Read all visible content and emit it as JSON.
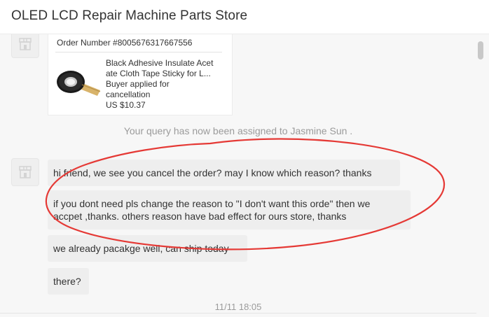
{
  "header": {
    "title": "OLED LCD Repair Machine Parts Store"
  },
  "order": {
    "number_label": "Order Number #8005676317667556",
    "product_lines": [
      "Black Adhesive Insulate Acet",
      "ate Cloth Tape Sticky for L..."
    ],
    "status_lines": [
      "Buyer applied for",
      "cancellation"
    ],
    "price": "US $10.37"
  },
  "system_message": "Your query has now been assigned to Jasmine Sun .",
  "messages": [
    {
      "lines": [
        "hi friend, we see you cancel the order? may I know which reason? thanks"
      ]
    },
    {
      "lines": [
        "if you dont need pls change the reason to \"I don't want this orde\" then we",
        "accpet ,thanks. others reason have bad effect for ours store, thanks"
      ]
    },
    {
      "lines": [
        "we already pacakge well, can ship today"
      ]
    },
    {
      "lines": [
        "there?"
      ]
    }
  ],
  "timestamp": "11/11 18:05",
  "colors": {
    "annotation_ellipse": "#e53935",
    "chat_background": "#f7f7f7",
    "bubble": "#eeeeee"
  },
  "icons": {
    "avatar": "store-icon",
    "product": "tape-roll-icon"
  }
}
